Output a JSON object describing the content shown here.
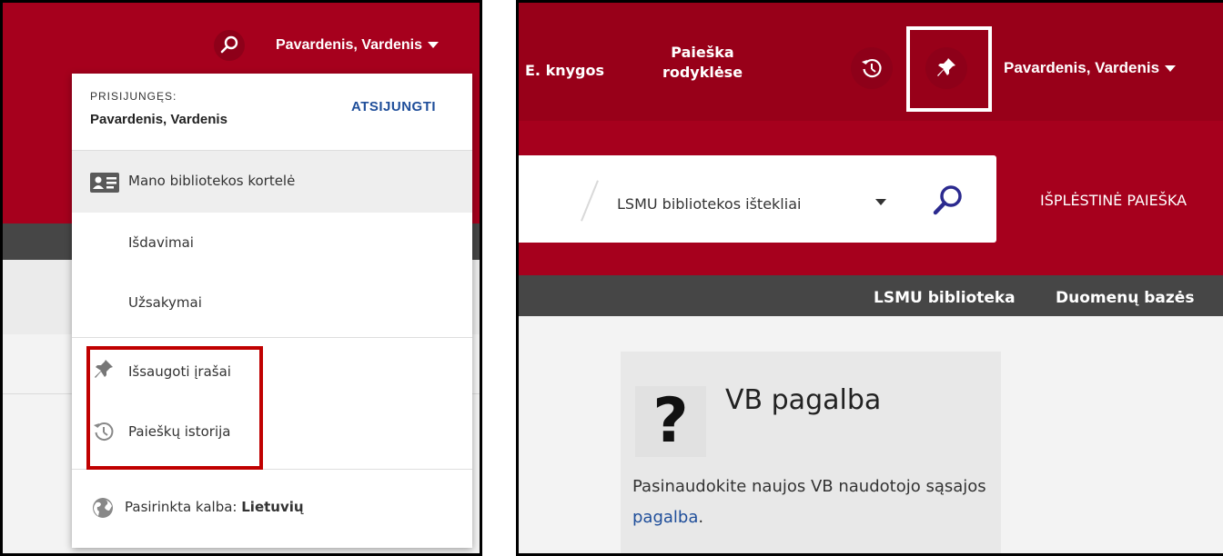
{
  "left_panel": {
    "header": {
      "user_name": "Pavardenis, Vardenis"
    },
    "dropdown": {
      "logged_in_label": "PRISIJUNGĘS:",
      "user_name": "Pavardenis, Vardenis",
      "logout_label": "ATSIJUNGTI",
      "items": [
        {
          "label": "Mano bibliotekos kortelė",
          "icon": "library-card-icon"
        },
        {
          "label": "Išdavimai"
        },
        {
          "label": "Užsakymai"
        },
        {
          "label": "Išsaugoti įrašai",
          "icon": "pin-icon"
        },
        {
          "label": "Paieškų istorija",
          "icon": "history-icon"
        }
      ],
      "language_label": "Pasirinkta kalba:",
      "language_value": "Lietuvių"
    },
    "highlight_color": "#c00000"
  },
  "right_panel": {
    "nav": {
      "ebooks": "E. knygos",
      "index_search_line1": "Paieška",
      "index_search_line2": "rodyklėse",
      "user_name": "Pavardenis, Vardenis"
    },
    "search": {
      "scope": "LSMU bibliotekos ištekliai",
      "advanced_label": "IŠPLĖSTINĖ PAIEŠKA"
    },
    "subnav": [
      "LSMU biblioteka",
      "Duomenų bazės"
    ],
    "help_card": {
      "title": "VB pagalba",
      "text_before": "Pasinaudokite naujos VB naudotojo sąsajos ",
      "link": "pagalba",
      "text_after": "."
    }
  },
  "colors": {
    "brand_red": "#a6001d",
    "dark_bar": "#464646",
    "link_blue": "#1f4e9a",
    "search_icon": "#2b2a8f"
  }
}
